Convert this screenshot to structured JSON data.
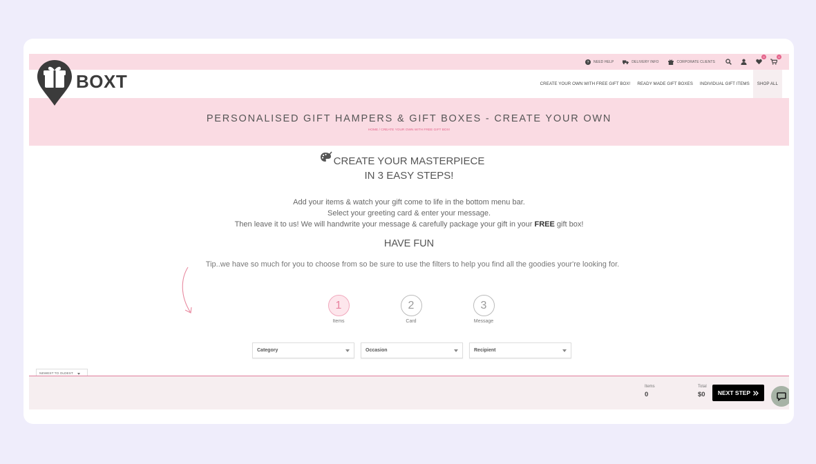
{
  "colors": {
    "accent": "#e4638a",
    "pink_bg": "#fadbe3",
    "page_bg": "#efedfb",
    "button": "#000000"
  },
  "utility": {
    "need_help": "NEED HELP",
    "delivery_info": "DELIVERY INFO",
    "corporate": "CORPORATE CLIENTS",
    "wishlist_count": "0",
    "cart_count": "0"
  },
  "logo": {
    "text": "BOXT"
  },
  "nav": {
    "create_own": "CREATE YOUR OWN WITH FREE GIFT BOX!",
    "ready_made": "READY MADE GIFT BOXES",
    "individual": "INDIVIDUAL GIFT ITEMS",
    "shop_all": "SHOP ALL"
  },
  "hero": {
    "title": "PERSONALISED GIFT HAMPERS & GIFT BOXES - CREATE YOUR OWN",
    "breadcrumb_home": "HOME",
    "breadcrumb_sep": "/",
    "breadcrumb_current": "CREATE YOUR OWN WITH FREE GIFT BOX!"
  },
  "content": {
    "title_line1": "CREATE YOUR MASTERPIECE",
    "title_line2": "IN 3 EASY STEPS!",
    "intro_line1": "Add your items & watch your gift come to life in the bottom menu bar.",
    "intro_line2": "Select your greeting card & enter your message.",
    "intro_line3_pre": "Then leave it to us! We will handwrite your message & carefully package your gift in your ",
    "intro_line3_bold": "FREE",
    "intro_line3_post": " gift box!",
    "have_fun": "HAVE FUN",
    "tip": "Tip..we have so much for you to choose from so be sure to use the filters to help you find all the goodies your're looking for."
  },
  "steps": [
    {
      "number": "1",
      "label": "Items"
    },
    {
      "number": "2",
      "label": "Card"
    },
    {
      "number": "3",
      "label": "Message"
    }
  ],
  "filters": {
    "category": "Category",
    "occasion": "Occasion",
    "recipient": "Recipient"
  },
  "sort": {
    "value": "NEWEST TO OLDEST"
  },
  "bottom": {
    "items_label": "Items",
    "items_value": "0",
    "total_label": "Total",
    "total_value": "$0",
    "next_step": "NEXT STEP"
  }
}
